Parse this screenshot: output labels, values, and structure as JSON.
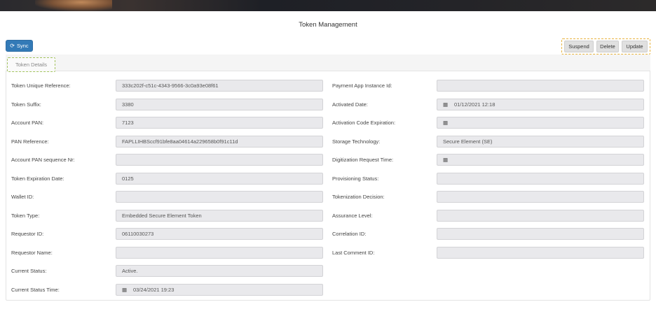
{
  "page": {
    "title": "Token Management"
  },
  "toolbar": {
    "sync_label": "Sync",
    "sync_icon": "refresh-icon",
    "suspend_label": "Suspend",
    "delete_label": "Delete",
    "update_label": "Update"
  },
  "tabs": [
    {
      "label": "Token Details",
      "active": true
    }
  ],
  "left_fields": [
    {
      "label": "Token Unique Reference:",
      "value": "333c202f-c51c-4343-9566-3c0a93e08f61"
    },
    {
      "label": "Token Suffix:",
      "value": "3380"
    },
    {
      "label": "Account PAN:",
      "value": "7123"
    },
    {
      "label": "PAN Reference:",
      "value": "FAPLLIHBSccf91bfe8aa04614a229658b0f91c11d"
    },
    {
      "label": "Account PAN sequence Nr:",
      "value": ""
    },
    {
      "label": "Token Expiration Date:",
      "value": "0125"
    },
    {
      "label": "Wallet ID:",
      "value": ""
    },
    {
      "label": "Token Type:",
      "value": "Embedded Secure Element Token"
    },
    {
      "label": "Requestor ID:",
      "value": "06110030273"
    },
    {
      "label": "Requestor Name:",
      "value": ""
    },
    {
      "label": "Current Status:",
      "value": "Active."
    },
    {
      "label": "Current Status Time:",
      "value": "03/24/2021 19:23"
    }
  ],
  "right_fields": [
    {
      "label": "Payment App Instance Id:",
      "value": ""
    },
    {
      "label": "Activated Date:",
      "value": "01/12/2021 12:18"
    },
    {
      "label": "Activation Code Expiration:",
      "value": ""
    },
    {
      "label": "Storage Technology:",
      "value": "Secure Element (SE)"
    },
    {
      "label": "Digitization Request Time:",
      "value": ""
    },
    {
      "label": "Provisioning Status:",
      "value": ""
    },
    {
      "label": "Tokenization Decision:",
      "value": ""
    },
    {
      "label": "Assurance Level:",
      "value": ""
    },
    {
      "label": "Correlation ID:",
      "value": ""
    },
    {
      "label": "Last Comment ID:",
      "value": ""
    }
  ],
  "icons": {
    "calendar": "calendar-icon",
    "calendar_glyph": "▦"
  },
  "colors": {
    "primary": "#337ab7",
    "action_highlight": "#e8b33e",
    "tab_highlight": "#a4c45f"
  }
}
